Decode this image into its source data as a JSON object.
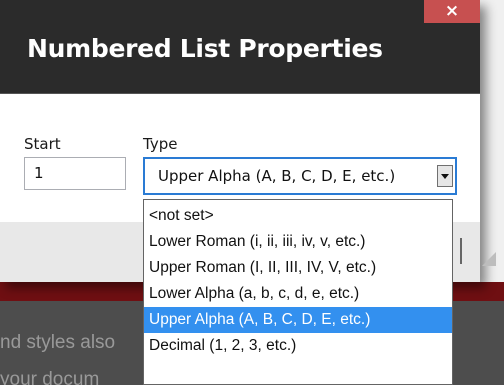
{
  "dialog": {
    "title": "Numbered List Properties",
    "close_label": "×"
  },
  "form": {
    "start_label": "Start",
    "start_value": "1",
    "type_label": "Type",
    "type_selected": "Upper Alpha (A, B, C, D, E, etc.)"
  },
  "dropdown": {
    "options": [
      "<not set>",
      "Lower Roman (i, ii, iii, iv, v, etc.)",
      "Upper Roman (I, II, III, IV, V, etc.)",
      "Lower Alpha (a, b, c, d, e, etc.)",
      "Upper Alpha (A, B, C, D, E, etc.)",
      "Decimal (1, 2, 3, etc.)"
    ],
    "selected_index": 4
  },
  "background": {
    "line1": "nd styles also",
    "line2": "your docum"
  },
  "colors": {
    "titlebar": "#2b2b2b",
    "close_button": "#c75050",
    "select_border": "#2a7bd4",
    "selected_option": "#3390ef",
    "backdrop_maroon": "#6f0f12"
  }
}
